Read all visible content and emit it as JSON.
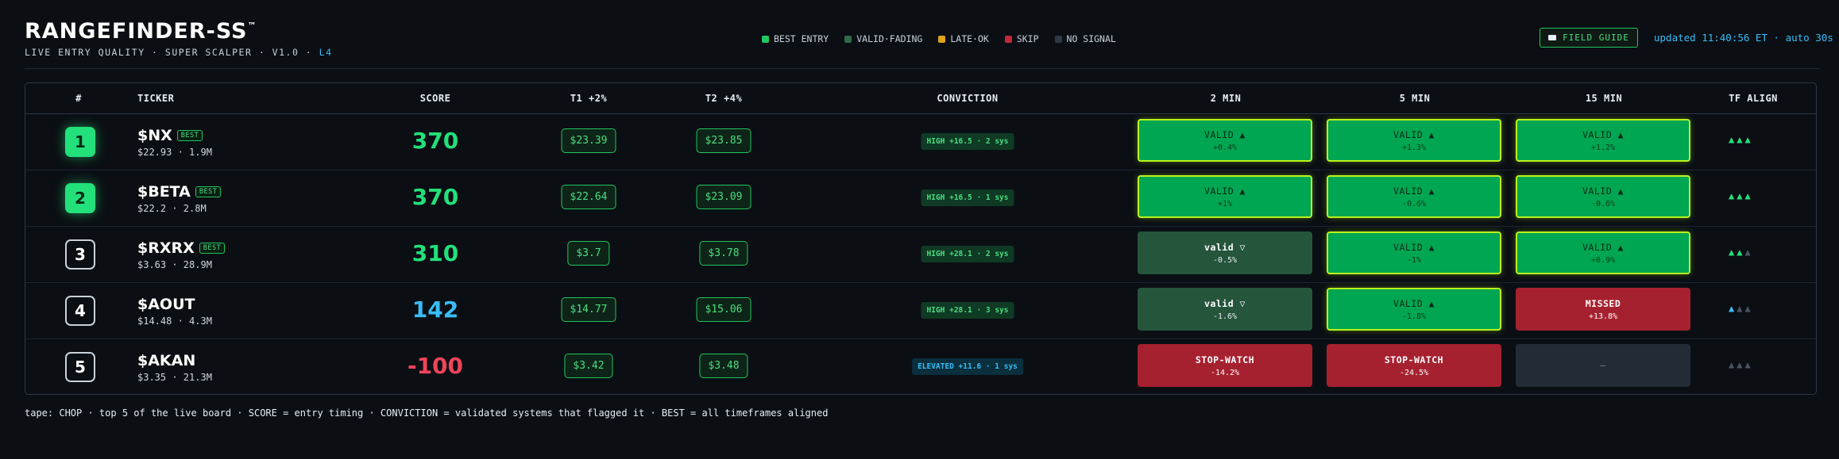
{
  "brand": {
    "title": "RANGEFINDER-SS",
    "tm": "™",
    "subtitle": "LIVE ENTRY QUALITY · SUPER SCALPER · V1.0 · ",
    "level": "L4"
  },
  "legend": [
    {
      "label": "BEST ENTRY",
      "color": "#22c55e"
    },
    {
      "label": "VALID·FADING",
      "color": "#2f6b49"
    },
    {
      "label": "LATE·OK",
      "color": "#e0a21a"
    },
    {
      "label": "SKIP",
      "color": "#c2283a"
    },
    {
      "label": "NO SIGNAL",
      "color": "#2f3843"
    }
  ],
  "field_guide": {
    "label": "FIELD GUIDE",
    "icon": "book-icon"
  },
  "updated": "updated 11:40:56 ET · auto 30s",
  "columns": [
    "#",
    "TICKER",
    "SCORE",
    "T1 +2%",
    "T2 +4%",
    "CONVICTION",
    "2 MIN",
    "5 MIN",
    "15 MIN",
    "TF ALIGN"
  ],
  "rows": [
    {
      "rank": "1",
      "best": true,
      "symbol": "$NX",
      "badge": "BEST",
      "sub": "$22.93 · 1.9M",
      "score": "370",
      "score_color": "#22e07a",
      "t1": "$23.39",
      "t2": "$23.85",
      "conviction": "HIGH +16.5 · 2 sys",
      "conv_type": "high",
      "tf": [
        {
          "state": "valid",
          "label": "VALID ▲",
          "pct": "+0.4%"
        },
        {
          "state": "valid",
          "label": "VALID ▲",
          "pct": "+1.3%"
        },
        {
          "state": "valid",
          "label": "VALID ▲",
          "pct": "+1.2%"
        }
      ],
      "align": [
        "#22e07a",
        "#22e07a",
        "#22e07a"
      ]
    },
    {
      "rank": "2",
      "best": true,
      "symbol": "$BETA",
      "badge": "BEST",
      "sub": "$22.2 · 2.8M",
      "score": "370",
      "score_color": "#22e07a",
      "t1": "$22.64",
      "t2": "$23.09",
      "conviction": "HIGH +16.5 · 1 sys",
      "conv_type": "high",
      "tf": [
        {
          "state": "valid",
          "label": "VALID ▲",
          "pct": "+1%"
        },
        {
          "state": "valid",
          "label": "VALID ▲",
          "pct": "-0.6%"
        },
        {
          "state": "valid",
          "label": "VALID ▲",
          "pct": "-0.6%"
        }
      ],
      "align": [
        "#22e07a",
        "#22e07a",
        "#22e07a"
      ]
    },
    {
      "rank": "3",
      "best": false,
      "symbol": "$RXRX",
      "badge": "BEST",
      "sub": "$3.63 · 28.9M",
      "score": "310",
      "score_color": "#22e07a",
      "t1": "$3.7",
      "t2": "$3.78",
      "conviction": "HIGH +28.1 · 2 sys",
      "conv_type": "high",
      "tf": [
        {
          "state": "fading",
          "label": "valid ▽",
          "pct": "-0.5%"
        },
        {
          "state": "valid",
          "label": "VALID ▲",
          "pct": "-1%"
        },
        {
          "state": "valid",
          "label": "VALID ▲",
          "pct": "+0.9%"
        }
      ],
      "align": [
        "#22e07a",
        "#22e07a",
        "#4b5561"
      ]
    },
    {
      "rank": "4",
      "best": false,
      "symbol": "$AOUT",
      "badge": "",
      "sub": "$14.48 · 4.3M",
      "score": "142",
      "score_color": "#38bdf8",
      "t1": "$14.77",
      "t2": "$15.06",
      "conviction": "HIGH +28.1 · 3 sys",
      "conv_type": "high",
      "tf": [
        {
          "state": "fading",
          "label": "valid ▽",
          "pct": "-1.6%"
        },
        {
          "state": "valid",
          "label": "VALID ▲",
          "pct": "-1.8%"
        },
        {
          "state": "missed",
          "label": "MISSED",
          "pct": "+13.8%"
        }
      ],
      "align": [
        "#38bdf8",
        "#4b5561",
        "#4b5561"
      ]
    },
    {
      "rank": "5",
      "best": false,
      "symbol": "$AKAN",
      "badge": "",
      "sub": "$3.35 · 21.3M",
      "score": "-100",
      "score_color": "#f0445a",
      "t1": "$3.42",
      "t2": "$3.48",
      "conviction": "ELEVATED +11.6 · 1 sys",
      "conv_type": "elev",
      "tf": [
        {
          "state": "stop",
          "label": "STOP-WATCH",
          "pct": "-14.2%"
        },
        {
          "state": "stop",
          "label": "STOP-WATCH",
          "pct": "-24.5%"
        },
        {
          "state": "none",
          "label": "—",
          "pct": ""
        }
      ],
      "align": [
        "#4b5561",
        "#4b5561",
        "#4b5561"
      ]
    }
  ],
  "footer": "tape: CHOP · top 5 of the live board · SCORE = entry timing · CONVICTION = validated systems that flagged it · BEST = all timeframes aligned"
}
